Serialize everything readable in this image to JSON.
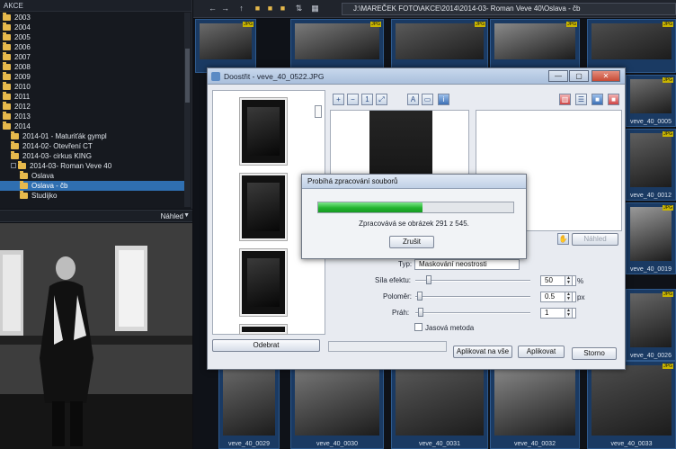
{
  "tree": {
    "header": "AKCE",
    "folders": [
      "2003",
      "2004",
      "2005",
      "2006",
      "2007",
      "2008",
      "2009",
      "2010",
      "2011",
      "2012",
      "2013",
      "2014"
    ],
    "sub2014": [
      "2014-01 - Maturiťák gympl",
      "2014-02- Otevření CT",
      "2014-03- cirkus KING",
      "2014-03- Roman Veve 40"
    ],
    "sub_roman": [
      "Oslava",
      "Oslava - čb",
      "Studijko"
    ]
  },
  "preview": {
    "label": "Náhled"
  },
  "toolbar": {
    "path": "J:\\MAREČEK FOTO\\AKCE\\2014\\2014-03- Roman Veve 40\\Oslava - čb"
  },
  "grid": {
    "captions": [
      "veve_40_0005",
      "veve_40_0012",
      "veve_40_0019",
      "veve_40_0026",
      "veve_40_0029",
      "veve_40_0030",
      "veve_40_0031",
      "veve_40_0032",
      "veve_40_0033"
    ],
    "jpg_tag": "JPG"
  },
  "dialog": {
    "title": "Doostřit - veve_40_0522.JPG",
    "preview_button": "Náhled",
    "type_label": "Typ:",
    "type_value": "Maskování neostrosti",
    "strength_label": "Síla efektu:",
    "strength_value": "50",
    "strength_unit": "%",
    "radius_label": "Poloměr:",
    "radius_value": "0.5",
    "radius_unit": "px",
    "threshold_label": "Práh:",
    "threshold_value": "1",
    "brightness_label": "Jasová metoda",
    "remove_button": "Odebrat",
    "apply_all_button": "Aplikovat na vše",
    "apply_button": "Aplikovat",
    "cancel_button": "Storno"
  },
  "progress": {
    "title": "Probíhá zpracování souborů",
    "message": "Zpracovává se obrázek 291 z 545.",
    "current": 291,
    "total": 545,
    "cancel_button": "Zrušit"
  },
  "colors": {
    "progress_green": "#22b42f",
    "selection_blue": "#2f6fb1",
    "folder_yellow": "#e6b94c"
  }
}
